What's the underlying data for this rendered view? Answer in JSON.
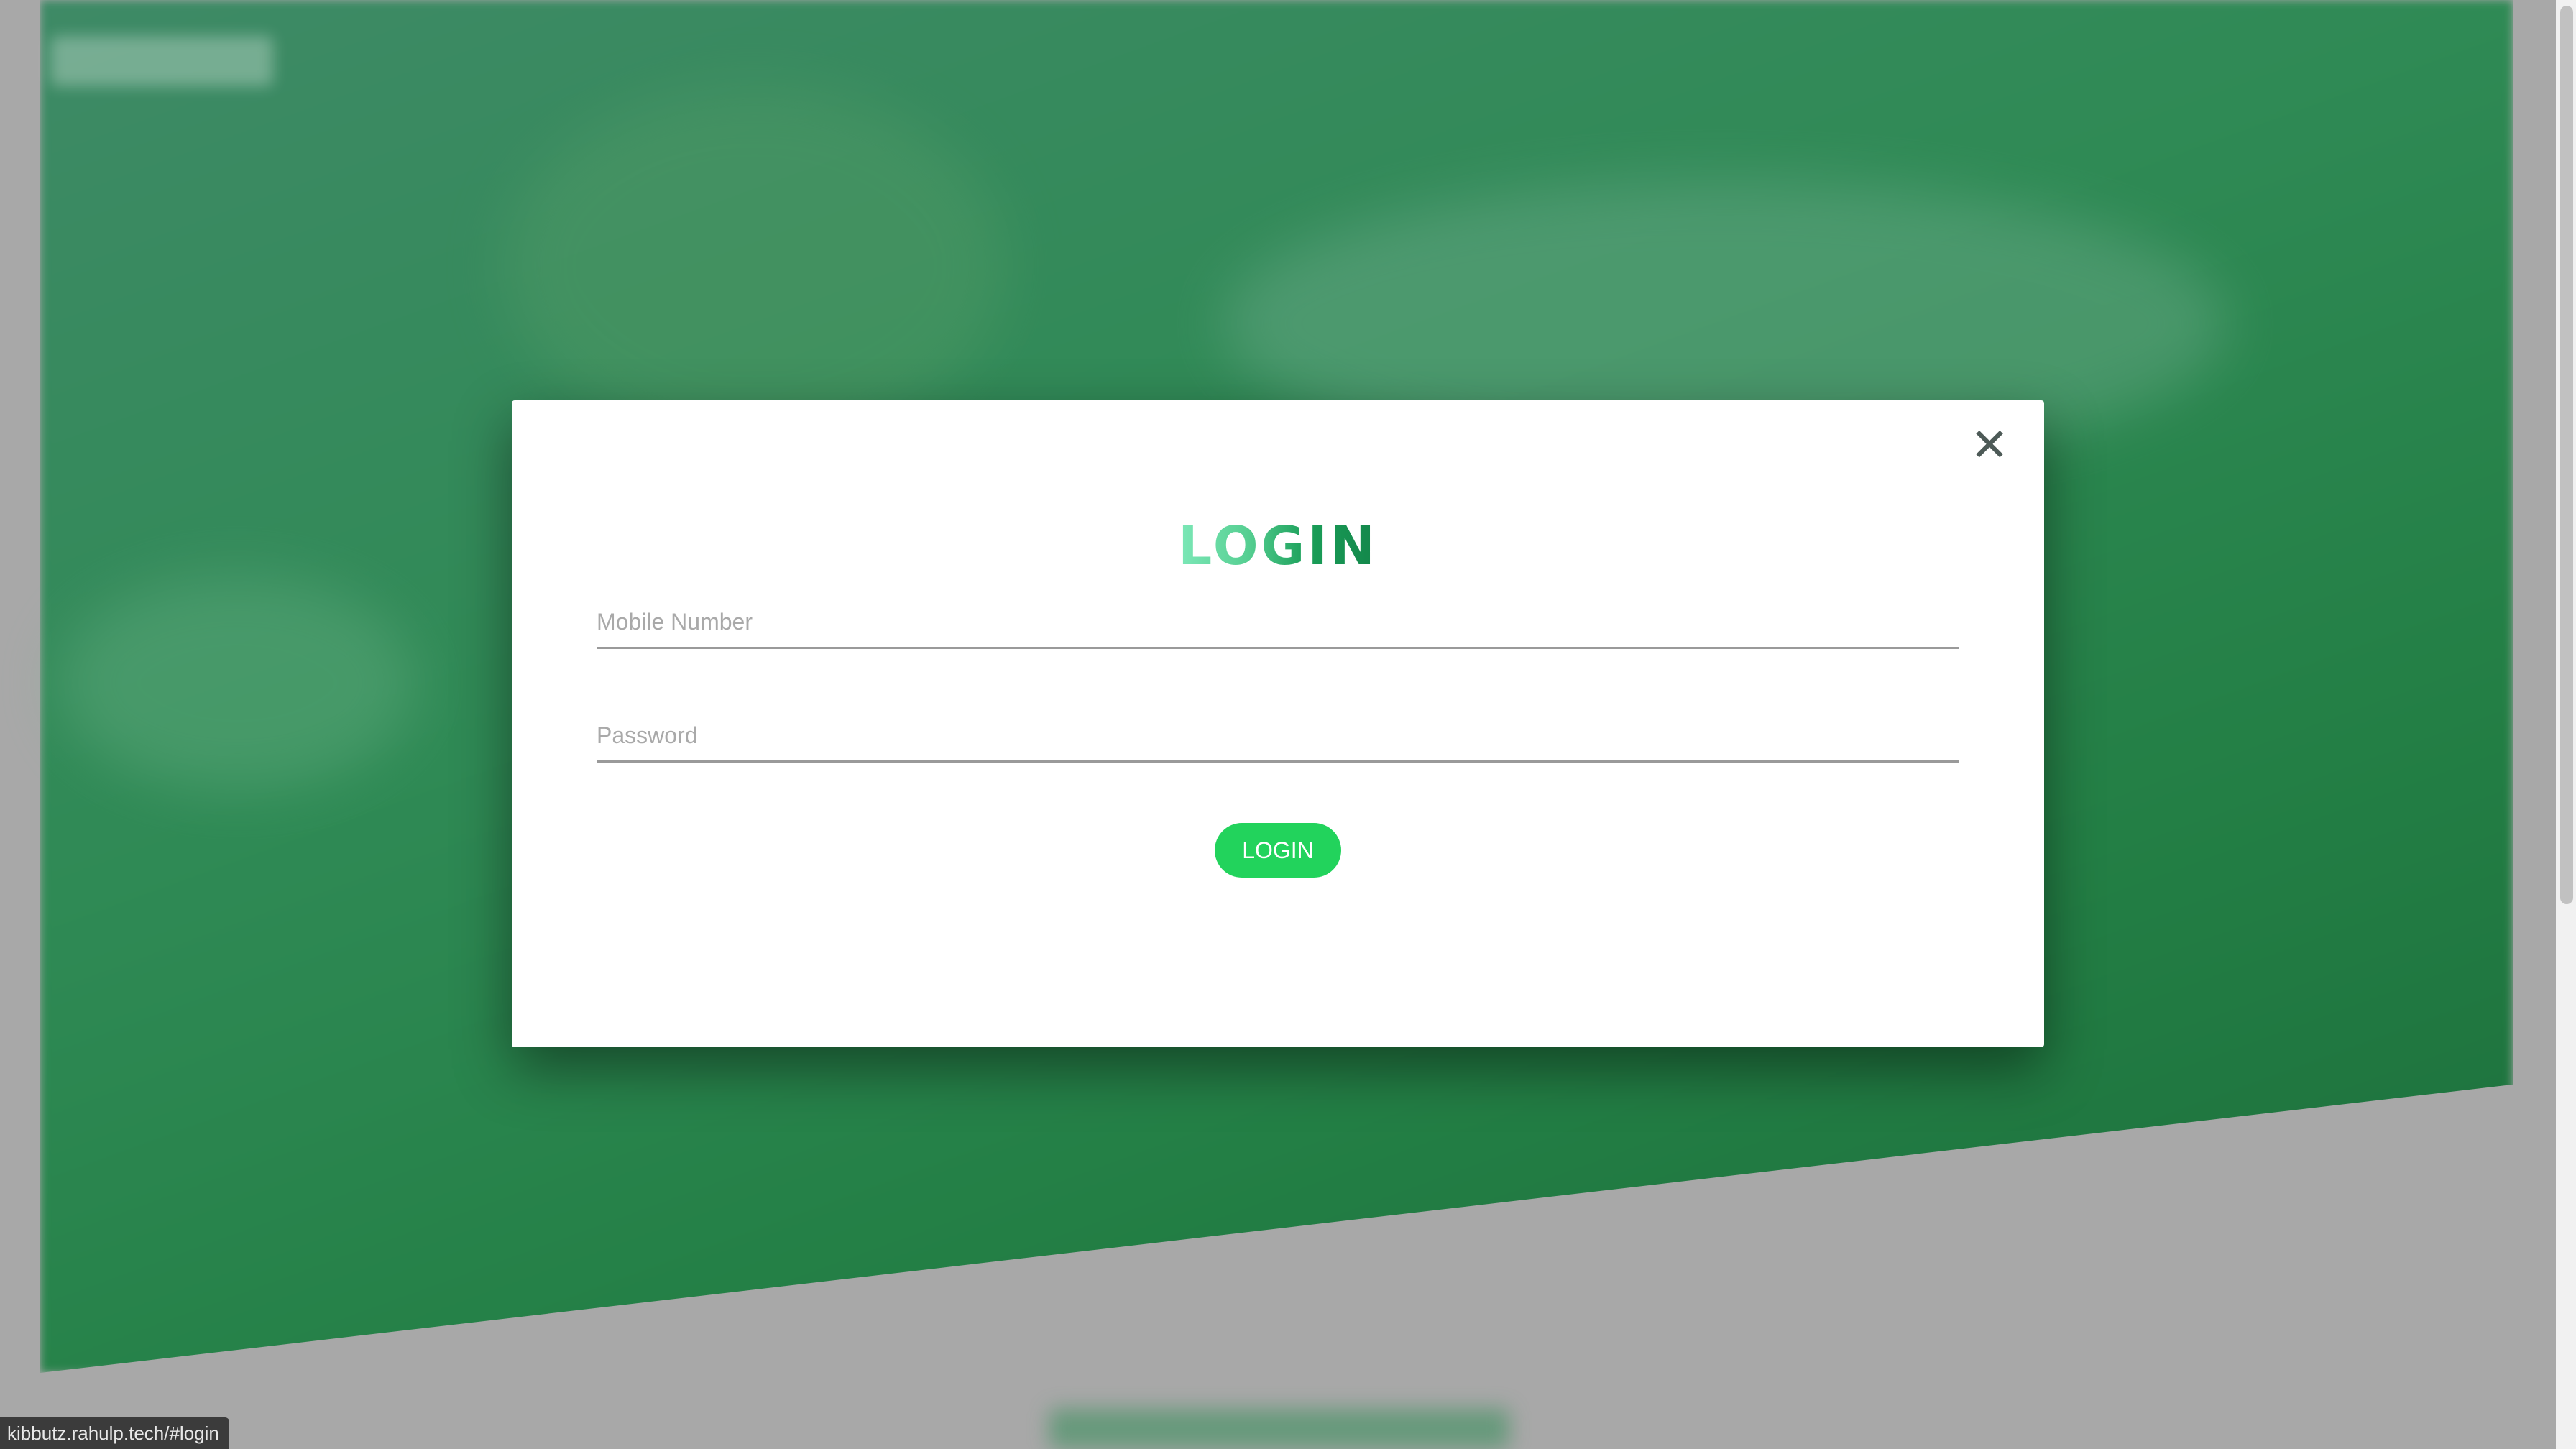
{
  "modal": {
    "title": "LOGIN",
    "close_glyph": "✕",
    "close_icon": "close-icon",
    "mobile_placeholder": "Mobile Number",
    "mobile_value": "",
    "password_placeholder": "Password",
    "password_value": "",
    "submit_label": "LOGIN"
  },
  "status_bar": {
    "url": "kibbutz.rahulp.tech/#login"
  },
  "colors": {
    "accent": "#22d35c",
    "title_gradient_start": "#7de8b8",
    "title_gradient_end": "#13864a",
    "background_green": "#2f8a55",
    "overlay_gray": "#a8a8a8"
  }
}
